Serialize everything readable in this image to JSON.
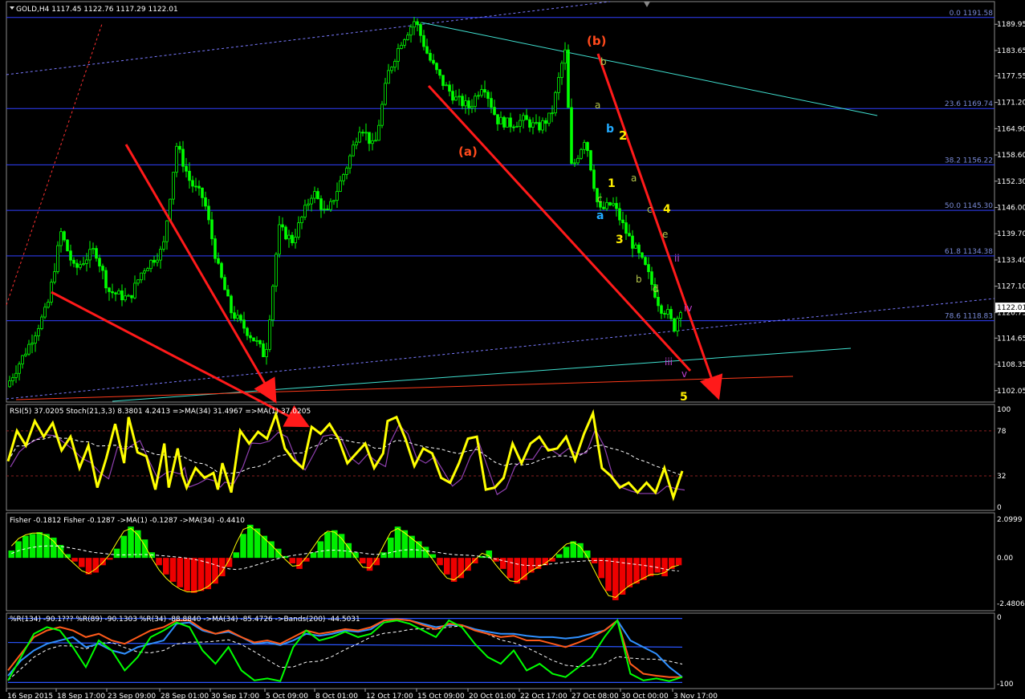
{
  "chart_data": [
    {
      "type": "candlestick",
      "symbol_header": "GOLD,H4  1117.45  1122.76  1117.29  1122.01",
      "ylim": [
        1099.5,
        1195
      ],
      "yticks": [
        "1189.95",
        "1183.65",
        "1177.55",
        "1171.20",
        "1164.90",
        "1158.60",
        "1152.30",
        "1146.00",
        "1139.70",
        "1133.40",
        "1127.10",
        "1120.75",
        "1114.65",
        "1108.35",
        "1102.05"
      ],
      "ytick_values": [
        1189.95,
        1183.65,
        1177.55,
        1171.2,
        1164.9,
        1158.6,
        1152.3,
        1146.0,
        1139.7,
        1133.4,
        1127.1,
        1120.75,
        1114.65,
        1108.35,
        1102.05
      ],
      "current_price": "1122.01",
      "fib_levels": [
        {
          "label": "0.0 1191.58",
          "value": 1191.58
        },
        {
          "label": "23.6 1169.74",
          "value": 1169.74
        },
        {
          "label": "38.2 1156.22",
          "value": 1156.22
        },
        {
          "label": "50.0 1145.30",
          "value": 1145.3
        },
        {
          "label": "61.8 1134.38",
          "value": 1134.38
        },
        {
          "label": "78.6 1118.83",
          "value": 1118.83
        }
      ],
      "price_path": [
        [
          0,
          1103
        ],
        [
          3,
          1112
        ],
        [
          6,
          1122
        ],
        [
          8,
          1140
        ],
        [
          10,
          1131
        ],
        [
          13,
          1136
        ],
        [
          15,
          1126
        ],
        [
          18,
          1124
        ],
        [
          20,
          1131
        ],
        [
          23,
          1136
        ],
        [
          25,
          1161
        ],
        [
          27,
          1152
        ],
        [
          29,
          1148
        ],
        [
          31,
          1132
        ],
        [
          33,
          1121
        ],
        [
          35,
          1117
        ],
        [
          37,
          1113
        ],
        [
          38,
          1110
        ],
        [
          40,
          1141
        ],
        [
          42,
          1138
        ],
        [
          45,
          1150
        ],
        [
          47,
          1144
        ],
        [
          50,
          1156
        ],
        [
          52,
          1166
        ],
        [
          54,
          1160
        ],
        [
          56,
          1178
        ],
        [
          58,
          1186
        ],
        [
          60,
          1191
        ],
        [
          62,
          1182
        ],
        [
          64,
          1176
        ],
        [
          66,
          1172
        ],
        [
          68,
          1170
        ],
        [
          70,
          1176
        ],
        [
          72,
          1167
        ],
        [
          74,
          1166
        ],
        [
          76,
          1167
        ],
        [
          78,
          1165
        ],
        [
          80,
          1168
        ],
        [
          82,
          1184
        ],
        [
          83,
          1155
        ],
        [
          85,
          1163
        ],
        [
          87,
          1145
        ],
        [
          89,
          1147
        ],
        [
          91,
          1140
        ],
        [
          93,
          1134
        ],
        [
          94,
          1131
        ],
        [
          96,
          1122
        ],
        [
          97,
          1121
        ],
        [
          98,
          1117
        ],
        [
          99,
          1122
        ]
      ],
      "x_tick_labels": [
        "16 Sep 2015",
        "18 Sep 17:00",
        "23 Sep 09:00",
        "28 Sep 01:00",
        "30 Sep 17:00",
        "5 Oct 09:00",
        "8 Oct 01:00",
        "12 Oct 17:00",
        "15 Oct 09:00",
        "20 Oct 01:00",
        "22 Oct 17:00",
        "27 Oct 08:00",
        "30 Oct 00:00",
        "3 Nov 17:00"
      ],
      "wave_labels": [
        {
          "text": "(b)",
          "color": "#ff4a1c"
        },
        {
          "text": "(a)",
          "color": "#ff4a1c"
        },
        {
          "text": "b",
          "color": "#22aaff"
        },
        {
          "text": "a",
          "color": "#22aaff"
        },
        {
          "text": "2",
          "color": "#ffee00"
        },
        {
          "text": "1",
          "color": "#ffee00"
        },
        {
          "text": "3",
          "color": "#ffee00"
        },
        {
          "text": "4",
          "color": "#ffee00"
        },
        {
          "text": "5",
          "color": "#ffee00"
        },
        {
          "text": "c",
          "color": "#b3c44a"
        },
        {
          "text": "a",
          "color": "#b3c44a"
        },
        {
          "text": "c",
          "color": "#b3c44a"
        },
        {
          "text": "e",
          "color": "#b3c44a"
        },
        {
          "text": "b",
          "color": "#b3c44a"
        },
        {
          "text": "d",
          "color": "#b3c44a"
        },
        {
          "text": "a",
          "color": "#b3c44a"
        },
        {
          "text": "b",
          "color": "#b3c44a"
        },
        {
          "text": "ii",
          "color": "#c040d0"
        },
        {
          "text": "iv",
          "color": "#c040d0"
        },
        {
          "text": "iii",
          "color": "#c040d0"
        },
        {
          "text": "v",
          "color": "#c040d0"
        }
      ],
      "colors": {
        "candles": "#00ff00",
        "fib_lines": "#3040ff",
        "trend_arrows": "#ff1a1a"
      }
    },
    {
      "type": "line",
      "legend": "RSI(5) 37.0205  Stoch(21,3,3) 8.3801 4.2413  =>MA(34) 31.4967  =>MA(1) 37.0205",
      "ylim": [
        0,
        100
      ],
      "yticks": [
        "100",
        "78",
        "32",
        "0"
      ],
      "ytick_values": [
        100,
        78,
        32,
        0
      ],
      "levels": [
        78,
        32
      ],
      "series_points": [
        [
          0,
          47
        ],
        [
          2,
          78
        ],
        [
          4,
          63
        ],
        [
          6,
          88
        ],
        [
          8,
          72
        ],
        [
          10,
          86
        ],
        [
          12,
          58
        ],
        [
          14,
          72
        ],
        [
          16,
          40
        ],
        [
          18,
          63
        ],
        [
          20,
          20
        ],
        [
          22,
          50
        ],
        [
          24,
          85
        ],
        [
          26,
          45
        ],
        [
          27,
          92
        ],
        [
          29,
          56
        ],
        [
          31,
          52
        ],
        [
          33,
          18
        ],
        [
          35,
          65
        ],
        [
          36,
          20
        ],
        [
          38,
          60
        ],
        [
          39,
          33
        ],
        [
          40,
          20
        ],
        [
          42,
          40
        ],
        [
          44,
          30
        ],
        [
          46,
          35
        ],
        [
          47,
          18
        ],
        [
          48,
          45
        ],
        [
          50,
          15
        ],
        [
          52,
          78
        ],
        [
          54,
          65
        ],
        [
          56,
          77
        ],
        [
          58,
          70
        ],
        [
          60,
          95
        ],
        [
          62,
          60
        ],
        [
          64,
          48
        ],
        [
          66,
          40
        ],
        [
          68,
          82
        ],
        [
          70,
          75
        ],
        [
          72,
          85
        ],
        [
          74,
          70
        ],
        [
          76,
          45
        ],
        [
          78,
          55
        ],
        [
          80,
          65
        ],
        [
          82,
          40
        ],
        [
          84,
          55
        ],
        [
          85,
          88
        ],
        [
          87,
          92
        ],
        [
          89,
          70
        ],
        [
          91,
          42
        ],
        [
          93,
          60
        ],
        [
          95,
          55
        ],
        [
          97,
          30
        ],
        [
          99,
          25
        ],
        [
          101,
          45
        ],
        [
          103,
          70
        ],
        [
          105,
          72
        ],
        [
          107,
          18
        ],
        [
          109,
          20
        ],
        [
          111,
          30
        ],
        [
          113,
          65
        ],
        [
          115,
          45
        ],
        [
          117,
          65
        ],
        [
          119,
          72
        ],
        [
          121,
          58
        ],
        [
          123,
          60
        ],
        [
          125,
          72
        ],
        [
          127,
          48
        ],
        [
          129,
          75
        ],
        [
          131,
          96
        ],
        [
          133,
          40
        ],
        [
          135,
          32
        ],
        [
          137,
          20
        ],
        [
          139,
          25
        ],
        [
          141,
          15
        ],
        [
          143,
          25
        ],
        [
          145,
          15
        ],
        [
          147,
          40
        ],
        [
          149,
          10
        ],
        [
          151,
          37
        ]
      ],
      "series_points_range": [
        0,
        151
      ],
      "colors": {
        "rsi": "#ffff00",
        "stoch": "#9040b0",
        "ma": "#ffffff"
      }
    },
    {
      "type": "histogram",
      "legend": "Fisher -0.1812  Fisher -0.1287  ->MA(1) -0.1287  ->MA(34) -0.4410",
      "ylim": [
        -2.4806,
        2.0999
      ],
      "yticks": [
        "2.0999",
        "0.00",
        "-2.4806"
      ],
      "ytick_values": [
        2.0999,
        0.0,
        -2.4806
      ],
      "bars": [
        0.4,
        0.9,
        1.2,
        1.3,
        1.4,
        1.3,
        1.1,
        0.7,
        0.2,
        -0.2,
        -0.5,
        -0.9,
        -0.8,
        -0.4,
        -0.1,
        0.5,
        1.2,
        1.7,
        1.5,
        1.0,
        0.3,
        -0.4,
        -0.9,
        -1.3,
        -1.6,
        -1.8,
        -1.9,
        -1.8,
        -1.7,
        -1.4,
        -1.0,
        -0.5,
        0.3,
        1.3,
        1.8,
        1.6,
        1.2,
        0.9,
        0.5,
        0.1,
        -0.3,
        -0.6,
        -0.2,
        0.3,
        0.9,
        1.4,
        1.5,
        1.3,
        0.8,
        0.3,
        -0.3,
        -0.7,
        -0.4,
        0.3,
        1.1,
        1.7,
        1.5,
        1.2,
        0.9,
        0.6,
        0.2,
        -0.4,
        -0.9,
        -1.3,
        -1.1,
        -0.7,
        -0.3,
        0.1,
        0.4,
        -0.2,
        -0.6,
        -1.1,
        -1.4,
        -1.2,
        -0.8,
        -0.6,
        -0.4,
        -0.2,
        0.2,
        0.6,
        0.9,
        0.8,
        0.4,
        -0.3,
        -1.1,
        -1.8,
        -2.3,
        -2.0,
        -1.6,
        -1.4,
        -1.2,
        -1.0,
        -0.8,
        -1.0,
        -0.6,
        -0.4
      ],
      "colors": {
        "positive": "#00ee00",
        "negative": "#ee0000",
        "signal": "#ffff00",
        "ma": "#ffffff"
      }
    },
    {
      "type": "line",
      "legend": "%R(134) -90.1???  %R(89) -90.1303  %R(34) -88.8840  ->MA(34) -85.4726  ->Bands(200) -44.5031",
      "ylim": [
        -100,
        0
      ],
      "yticks": [
        "0",
        "-100"
      ],
      "ytick_values": [
        0,
        -100
      ],
      "series": [
        {
          "name": "%R(34)",
          "color": "#00ff00",
          "values": [
            -95,
            -60,
            -25,
            -15,
            -20,
            -45,
            -75,
            -35,
            -50,
            -80,
            -60,
            -30,
            -20,
            -8,
            -15,
            -50,
            -70,
            -45,
            -80,
            -95,
            -92,
            -96,
            -45,
            -20,
            -35,
            -30,
            -22,
            -30,
            -25,
            -8,
            -5,
            -10,
            -20,
            -30,
            -5,
            -15,
            -40,
            -60,
            -70,
            -50,
            -80,
            -70,
            -85,
            -90,
            -75,
            -60,
            -30,
            -5,
            -85,
            -95,
            -92,
            -96,
            -90
          ]
        },
        {
          "name": "%R(89)",
          "color": "#ff5a1a",
          "values": [
            -80,
            -55,
            -30,
            -20,
            -15,
            -20,
            -30,
            -25,
            -35,
            -40,
            -30,
            -20,
            -15,
            -5,
            -5,
            -18,
            -25,
            -20,
            -30,
            -38,
            -35,
            -40,
            -30,
            -20,
            -25,
            -22,
            -18,
            -20,
            -15,
            -5,
            -3,
            -5,
            -12,
            -18,
            -10,
            -12,
            -20,
            -25,
            -30,
            -28,
            -35,
            -35,
            -40,
            -45,
            -38,
            -30,
            -20,
            -5,
            -70,
            -85,
            -88,
            -90,
            -90
          ]
        },
        {
          "name": "%R(134)",
          "color": "#3090ff",
          "values": [
            -88,
            -65,
            -50,
            -40,
            -35,
            -30,
            -45,
            -40,
            -50,
            -55,
            -45,
            -40,
            -35,
            -10,
            -8,
            -20,
            -25,
            -22,
            -30,
            -40,
            -38,
            -42,
            -35,
            -25,
            -28,
            -25,
            -20,
            -22,
            -18,
            -5,
            -3,
            -5,
            -10,
            -15,
            -12,
            -12,
            -18,
            -22,
            -25,
            -25,
            -28,
            -30,
            -30,
            -32,
            -30,
            -25,
            -20,
            -5,
            -35,
            -45,
            -55,
            -75,
            -90
          ]
        }
      ],
      "colors": {
        "ma": "#ffffff",
        "bands": "#2a55ff"
      }
    }
  ]
}
